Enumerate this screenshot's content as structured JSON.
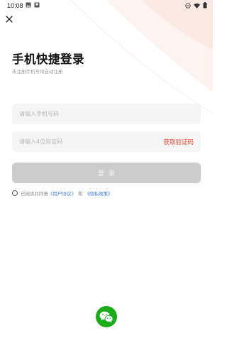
{
  "status_bar": {
    "time": "10:08"
  },
  "header": {
    "title": "手机快捷登录",
    "subtitle": "未注册手机号将自动注册"
  },
  "form": {
    "phone_placeholder": "请输入手机号码",
    "code_placeholder": "请输入4位验证码",
    "get_code_label": "获取验证码",
    "login_label": "登录"
  },
  "agreement": {
    "prefix": "已阅读并同意",
    "user_agreement": "《用户协议》",
    "and": "和",
    "privacy_policy": "《隐私政策》"
  },
  "icons": {
    "close": "close-icon",
    "wechat": "wechat-icon",
    "wifi": "wifi-icon",
    "battery": "battery-icon"
  },
  "colors": {
    "accent": "#e8482f",
    "link": "#3a7bd5",
    "login_disabled": "#cccccc",
    "wechat_green": "#1aad19",
    "input_bg": "#f5f5f5"
  }
}
